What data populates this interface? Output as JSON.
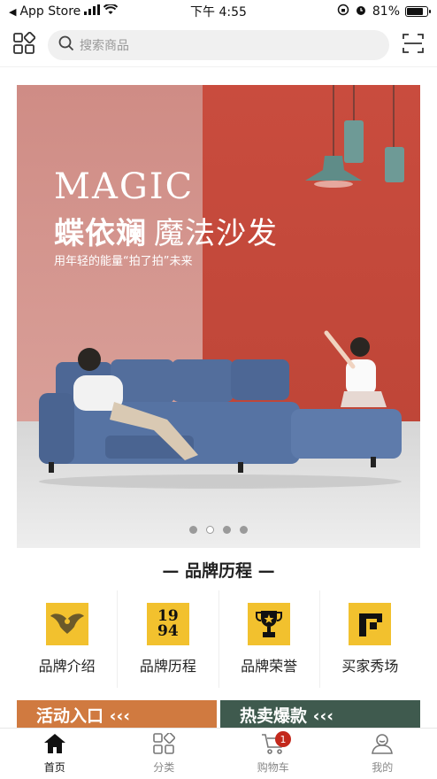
{
  "status_bar": {
    "back_app": "App Store",
    "time": "下午 4:55",
    "battery": "81%",
    "battery_level": 0.81
  },
  "header": {
    "search_placeholder": "搜索商品"
  },
  "banner": {
    "brand_en": "MAGIC",
    "title_main": "蝶依斓",
    "title_sub": "魔法沙发",
    "tagline": "用年轻的能量“拍了拍”未来",
    "slide_count": 4,
    "active_slide": 2
  },
  "section": {
    "title": "— 品牌历程 —"
  },
  "grid": [
    {
      "label": "品牌介绍",
      "icon": "wings-icon"
    },
    {
      "label": "品牌历程",
      "icon": "1994-icon",
      "icon_text_top": "19",
      "icon_text_bottom": "94"
    },
    {
      "label": "品牌荣誉",
      "icon": "trophy-icon"
    },
    {
      "label": "买家秀场",
      "icon": "gallery-icon"
    }
  ],
  "promos": [
    {
      "label": "活动入口 ‹‹‹",
      "color": "#d07a40"
    },
    {
      "label": "热卖爆款 ‹‹‹",
      "color": "#3f5a4e"
    }
  ],
  "tabs": [
    {
      "label": "首页",
      "icon": "home-icon",
      "active": true
    },
    {
      "label": "分类",
      "icon": "category-icon"
    },
    {
      "label": "购物车",
      "icon": "cart-icon",
      "badge": "1"
    },
    {
      "label": "我的",
      "icon": "user-icon"
    }
  ],
  "colors": {
    "accent_yellow": "#f2c12e",
    "badge_red": "#c3281c",
    "banner_red": "#c94c3e",
    "banner_pink": "#cf8c85"
  }
}
